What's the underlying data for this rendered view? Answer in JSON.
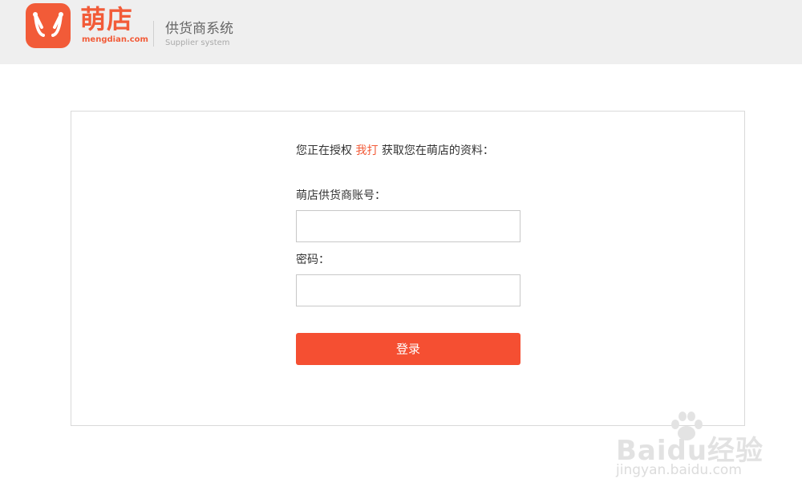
{
  "header": {
    "brand_name": "萌店",
    "brand_domain": "mengdian.com",
    "system_title": "供货商系统",
    "system_subtitle": "Supplier system",
    "brand_color": "#f25b38",
    "logo_icon": "shopping-bag-icon"
  },
  "auth": {
    "prefix": "您正在授权",
    "app_name": "我打",
    "suffix": "获取您在萌店的资料："
  },
  "form": {
    "account_label": "萌店供货商账号：",
    "account_value": "",
    "account_placeholder": "",
    "password_label": "密码：",
    "password_value": "",
    "password_placeholder": "",
    "login_label": "登录",
    "login_color": "#f54f32"
  },
  "watermark": {
    "brand": "Baidu经验",
    "url": "jingyan.baidu.com",
    "icon": "paw-icon"
  }
}
